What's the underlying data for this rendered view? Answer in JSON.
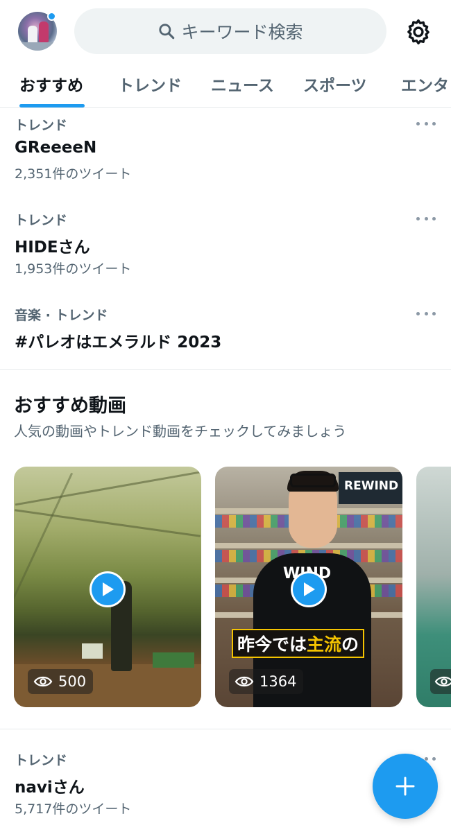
{
  "header": {
    "search_placeholder": "キーワード検索",
    "avatar_has_notification": true
  },
  "tabs": [
    {
      "label": "おすすめ",
      "active": true
    },
    {
      "label": "トレンド",
      "active": false
    },
    {
      "label": "ニュース",
      "active": false
    },
    {
      "label": "スポーツ",
      "active": false
    },
    {
      "label": "エンタ",
      "active": false
    }
  ],
  "trends": [
    {
      "meta": "トレンド",
      "name": "GReeeeN",
      "count": "2,351件のツイート"
    },
    {
      "meta": "トレンド",
      "name": "HIDEさん",
      "count": "1,953件のツイート"
    },
    {
      "meta": "音楽 · トレンド",
      "name": "#パレオはエメラルド 2023"
    }
  ],
  "video_section": {
    "title": "おすすめ動画",
    "subtitle": "人気の動画やトレンド動画をチェックしてみましょう",
    "videos": [
      {
        "views": "500"
      },
      {
        "views": "1364",
        "caption_pre": "昨今では",
        "caption_highlight": "主流",
        "caption_post": "の",
        "banner_text": "REWIND",
        "shirt_text": "WIND"
      },
      {
        "views": ""
      }
    ]
  },
  "trend_bottom": {
    "meta": "トレンド",
    "name": "naviさん",
    "count": "5,717件のツイート"
  },
  "colors": {
    "accent": "#1d9bf0",
    "text": "#0f1419",
    "secondary": "#536471",
    "divider": "#e6e9eb"
  },
  "icons": [
    "search-icon",
    "gear-icon",
    "more-icon",
    "play-icon",
    "eye-icon",
    "plus-icon"
  ]
}
